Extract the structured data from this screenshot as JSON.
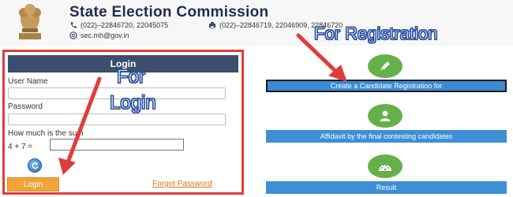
{
  "header": {
    "title": "State Election Commission",
    "phone1": "(022)–22846720, 22045075",
    "phone2": "(022)–22846719, 22046909, 22846720",
    "email": "sec.mh@gov.in",
    "icons": [
      "phone-icon",
      "fax-icon",
      "email-icon"
    ]
  },
  "login": {
    "heading": "Login",
    "username_label": "User Name",
    "password_label": "Password",
    "captcha_question": "How much is the sum",
    "captcha_equation": "4 + 7 =",
    "login_button": "Login",
    "forgot_password": "Forgot Password"
  },
  "options": {
    "registration_button": "Create a Candidate Registration for",
    "affidavit_button": "Affidavit by the final contesting candidates",
    "result_button": "Result",
    "icons": [
      "pencil-icon",
      "user-icon",
      "speedometer-icon"
    ]
  },
  "annotations": {
    "registration": "For Registration",
    "login_line1": "For",
    "login_line2": "Login"
  },
  "colors": {
    "header_title": "#1f2d52",
    "login_header": "#3c4d6e",
    "accent_orange": "#f2a43a",
    "button_blue": "#3d8fd6",
    "icon_green": "#66b04a",
    "annotation_red": "#e23b3b"
  }
}
